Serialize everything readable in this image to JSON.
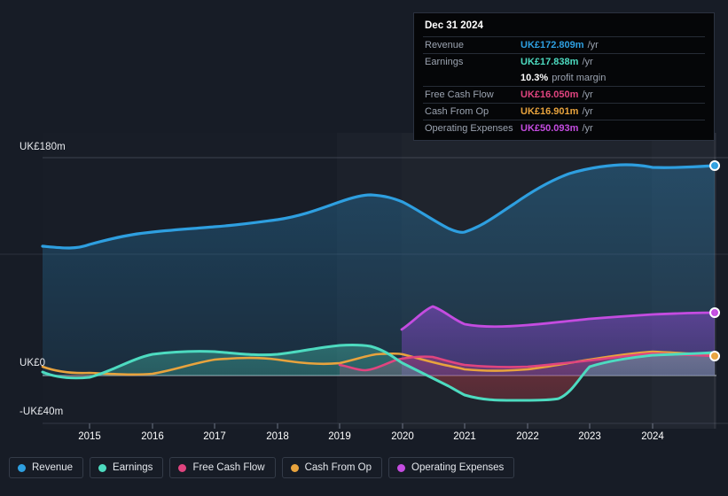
{
  "tooltip": {
    "date": "Dec 31 2024",
    "rows": [
      {
        "label": "Revenue",
        "value": "UK£172.809m",
        "suffix": "/yr",
        "color": "#2e9fe0"
      },
      {
        "label": "Earnings",
        "value": "UK£17.838m",
        "suffix": "/yr",
        "color": "#4ddbc0"
      },
      {
        "label": "",
        "value": "10.3%",
        "suffix": "profit margin",
        "color": "#ffffff"
      },
      {
        "label": "Free Cash Flow",
        "value": "UK£16.050m",
        "suffix": "/yr",
        "color": "#e0447f"
      },
      {
        "label": "Cash From Op",
        "value": "UK£16.901m",
        "suffix": "/yr",
        "color": "#e8a33d"
      },
      {
        "label": "Operating Expenses",
        "value": "UK£50.093m",
        "suffix": "/yr",
        "color": "#c44ce0"
      }
    ]
  },
  "legend": [
    {
      "label": "Revenue",
      "color": "#2e9fe0"
    },
    {
      "label": "Earnings",
      "color": "#4ddbc0"
    },
    {
      "label": "Free Cash Flow",
      "color": "#e0447f"
    },
    {
      "label": "Cash From Op",
      "color": "#e8a33d"
    },
    {
      "label": "Operating Expenses",
      "color": "#c44ce0"
    }
  ],
  "axis": {
    "y_labels": [
      {
        "text": "UK£180m",
        "value": 180
      },
      {
        "text": "UK£0",
        "value": 0
      },
      {
        "text": "-UK£40m",
        "value": -40
      }
    ],
    "x_labels": [
      "2015",
      "2016",
      "2017",
      "2018",
      "2019",
      "2020",
      "2021",
      "2022",
      "2023",
      "2024"
    ]
  },
  "chart_data": {
    "type": "line",
    "title": "",
    "xlabel": "",
    "ylabel": "UK£ (millions)",
    "ylim": [
      -40,
      180
    ],
    "xlim": [
      2014.25,
      2024.95
    ],
    "grid": true,
    "legend_position": "bottom",
    "currency": "UK£",
    "units": "millions per year",
    "x": [
      2014.25,
      2014.75,
      2015.25,
      2015.75,
      2016.25,
      2016.75,
      2017.25,
      2017.75,
      2018.25,
      2018.75,
      2019.25,
      2019.75,
      2020.25,
      2020.75,
      2021.25,
      2021.75,
      2022.25,
      2022.75,
      2023.25,
      2023.75,
      2024.25,
      2024.95
    ],
    "series": [
      {
        "name": "Revenue",
        "color": "#2e9fe0",
        "values": [
          107,
          105,
          112,
          116,
          117,
          120,
          122,
          124,
          128,
          134,
          143,
          149,
          148,
          138,
          125,
          119,
          128,
          142,
          154,
          164,
          170,
          172.809
        ]
      },
      {
        "name": "Earnings",
        "color": "#4ddbc0",
        "values": [
          3,
          -3,
          -1,
          8,
          15,
          17,
          18,
          17,
          15,
          17,
          20,
          21,
          19,
          13,
          5,
          -4,
          -18,
          -21,
          -21,
          5,
          12,
          17.838
        ]
      },
      {
        "name": "Free Cash Flow",
        "color": "#e0447f",
        "values": [
          null,
          null,
          null,
          null,
          null,
          null,
          null,
          null,
          null,
          9,
          4,
          9,
          13,
          12,
          9,
          7,
          6,
          7,
          10,
          13,
          15,
          16.05
        ]
      },
      {
        "name": "Cash From Op",
        "color": "#e8a33d",
        "values": [
          6,
          2,
          1,
          1,
          0,
          0,
          3,
          7,
          8,
          10,
          7,
          10,
          14,
          13,
          10,
          8,
          7,
          8,
          11,
          15,
          17,
          16.901
        ]
      },
      {
        "name": "Operating Expenses",
        "color": "#c44ce0",
        "values": [
          null,
          null,
          null,
          null,
          null,
          null,
          null,
          null,
          null,
          null,
          null,
          null,
          38,
          57,
          47,
          44,
          44,
          45,
          46,
          47,
          48,
          50.093
        ]
      }
    ],
    "annotations": [
      {
        "type": "endpoint-marker",
        "series": "Revenue",
        "x": 2024.95,
        "y": 172.809
      },
      {
        "type": "endpoint-marker",
        "series": "Operating Expenses",
        "x": 2024.95,
        "y": 50.093
      },
      {
        "type": "endpoint-marker",
        "series": "Cash From Op",
        "x": 2024.95,
        "y": 16.901
      }
    ]
  }
}
